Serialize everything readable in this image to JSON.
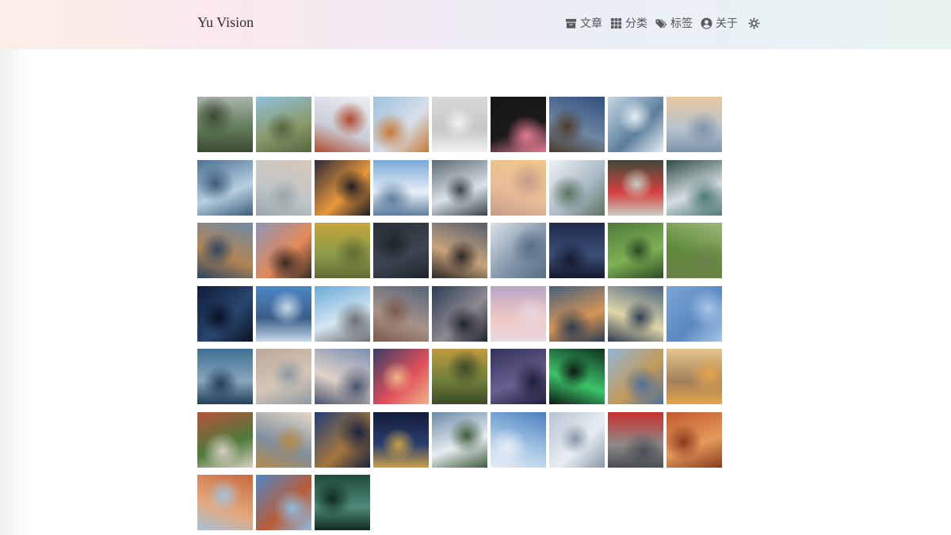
{
  "site": {
    "title": "Yu Vision"
  },
  "nav": {
    "items": [
      {
        "label": "文章",
        "icon": "archive-icon"
      },
      {
        "label": "分类",
        "icon": "grid-icon"
      },
      {
        "label": "标签",
        "icon": "tags-icon"
      },
      {
        "label": "关于",
        "icon": "user-circle-icon"
      }
    ],
    "theme_icon": "sun-gear-icon"
  },
  "gallery": {
    "count": 57,
    "photos": [
      [
        "#a9b3ad",
        "#5f7a55",
        "#3b4a33"
      ],
      [
        "#8fc1dc",
        "#8a9a6a",
        "#55653e"
      ],
      [
        "#eceff4",
        "#c9ced8",
        "#b04a2e"
      ],
      [
        "#9ec1dc",
        "#d7dfe9",
        "#c67a3a"
      ],
      [
        "#d9d9d9",
        "#c4c6c8",
        "#f2f2f2"
      ],
      [
        "#161414",
        "#1b1919",
        "#e37b95"
      ],
      [
        "#2e4f7e",
        "#6f86a2",
        "#4b3a2a"
      ],
      [
        "#c6d8e6",
        "#5c7f9d",
        "#e8eef4"
      ],
      [
        "#e8c8a0",
        "#b6c3cf",
        "#7e93a8"
      ],
      [
        "#4d7295",
        "#b8cfe1",
        "#3c5d7a"
      ],
      [
        "#d6c8b8",
        "#c0c6c9",
        "#9aa4a8"
      ],
      [
        "#2b2a3a",
        "#e9983a",
        "#1d1c24"
      ],
      [
        "#7aa9d9",
        "#e9eff5",
        "#5d7fa0"
      ],
      [
        "#5e6b73",
        "#d9e1e8",
        "#39454e"
      ],
      [
        "#f0c784",
        "#e7bd98",
        "#c69c8a"
      ],
      [
        "#eef2f5",
        "#a8b8c4",
        "#5d7260"
      ],
      [
        "#3f4a3a",
        "#d64040",
        "#c8cdc0"
      ],
      [
        "#2f4d46",
        "#d6dde2",
        "#4f7a76"
      ],
      [
        "#6f8aa7",
        "#b28454",
        "#2d4561"
      ],
      [
        "#8e94b6",
        "#e48a5a",
        "#3b2c26"
      ],
      [
        "#c3a63a",
        "#8c9a4a",
        "#5f6b33"
      ],
      [
        "#2a2f36",
        "#3d4552",
        "#1f242b"
      ],
      [
        "#545d6f",
        "#c9a37b",
        "#2a2626"
      ],
      [
        "#dbe2ea",
        "#7f93a8",
        "#5a6f84"
      ],
      [
        "#1f2a4a",
        "#3b4f77",
        "#141b30"
      ],
      [
        "#4d7a3a",
        "#7fb055",
        "#2c4a24"
      ],
      [
        "#9cb87a",
        "#5f8a3a",
        "#6d7f4c"
      ],
      [
        "#0f1d3a",
        "#28466f",
        "#0b1224"
      ],
      [
        "#4d86c6",
        "#3a5e88",
        "#c7d9ea"
      ],
      [
        "#6aaad8",
        "#d5e6f1",
        "#6d6f74"
      ],
      [
        "#54657a",
        "#a8928a",
        "#7a5a4a"
      ],
      [
        "#2b3c52",
        "#8e8a92",
        "#1f2430"
      ],
      [
        "#b9a6c8",
        "#f0c8c3",
        "#e8d8e0"
      ],
      [
        "#46607e",
        "#d69456",
        "#2b3c52"
      ],
      [
        "#4b6481",
        "#e0d6a8",
        "#2e3d52"
      ],
      [
        "#7ba6d6",
        "#5a88c0",
        "#a9c6e6"
      ],
      [
        "#3f6f93",
        "#89a6bb",
        "#1f3e58"
      ],
      [
        "#bca89a",
        "#d5c6b7",
        "#8e9aa3"
      ],
      [
        "#7d8fb2",
        "#e0d2c9",
        "#46536c"
      ],
      [
        "#3a3e66",
        "#e04f5a",
        "#f0b28a"
      ],
      [
        "#c09a3e",
        "#6d7e3a",
        "#3b4a2a"
      ],
      [
        "#31315a",
        "#6a5f8f",
        "#1e1f3a"
      ],
      [
        "#10301f",
        "#3cc46a",
        "#0d1a12"
      ],
      [
        "#93b6d6",
        "#c39a5a",
        "#4f6f9a"
      ],
      [
        "#e5c78d",
        "#a2805c",
        "#e4a44c"
      ],
      [
        "#b5533b",
        "#4e7a3a",
        "#d8cfc2"
      ],
      [
        "#e4d7c8",
        "#7f8f9e",
        "#b58a4a"
      ],
      [
        "#223e78",
        "#a4763e",
        "#17233f"
      ],
      [
        "#141d3a",
        "#2a3d6e",
        "#c9a04a"
      ],
      [
        "#6a8aa6",
        "#e7edf2",
        "#3e5b3c"
      ],
      [
        "#4a7fc0",
        "#a9c8e6",
        "#e7eef5"
      ],
      [
        "#b7c4d2",
        "#e8edf2",
        "#8898a8"
      ],
      [
        "#c92e2e",
        "#8e8a88",
        "#4b4f56"
      ],
      [
        "#c25a2e",
        "#e49a5a",
        "#8a3a1e"
      ],
      [
        "#c96a3e",
        "#e4a77a",
        "#a6c2da"
      ],
      [
        "#4f87c9",
        "#b95b36",
        "#8dbbe2"
      ],
      [
        "#1e4a3a",
        "#4e8a7a",
        "#0f2a22"
      ]
    ]
  }
}
